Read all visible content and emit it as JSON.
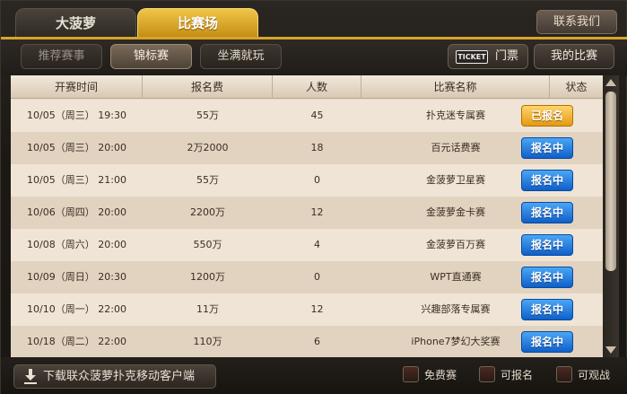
{
  "tabs": {
    "main": [
      "大菠萝",
      "比赛场"
    ],
    "active": 1,
    "contact": "联系我们"
  },
  "subtabs": {
    "items": [
      "推荐赛事",
      "锦标赛",
      "坐满就玩"
    ],
    "active": 1,
    "ticket_icon": "TICKET",
    "ticket_label": "门票",
    "my_matches": "我的比赛"
  },
  "table": {
    "headers": [
      "开赛时间",
      "报名费",
      "人数",
      "比赛名称",
      "状态"
    ],
    "rows": [
      {
        "time": "10/05（周三） 19:30",
        "fee": "55万",
        "count": "45",
        "name": "扑克迷专属赛",
        "status": "已报名",
        "status_style": "gold"
      },
      {
        "time": "10/05（周三） 20:00",
        "fee": "2万2000",
        "count": "18",
        "name": "百元话费赛",
        "status": "报名中",
        "status_style": "blue"
      },
      {
        "time": "10/05（周三） 21:00",
        "fee": "55万",
        "count": "0",
        "name": "金菠萝卫星赛",
        "status": "报名中",
        "status_style": "blue"
      },
      {
        "time": "10/06（周四） 20:00",
        "fee": "2200万",
        "count": "12",
        "name": "金菠萝金卡赛",
        "status": "报名中",
        "status_style": "blue"
      },
      {
        "time": "10/08（周六） 20:00",
        "fee": "550万",
        "count": "4",
        "name": "金菠萝百万赛",
        "status": "报名中",
        "status_style": "blue"
      },
      {
        "time": "10/09（周日） 20:30",
        "fee": "1200万",
        "count": "0",
        "name": "WPT直通赛",
        "status": "报名中",
        "status_style": "blue"
      },
      {
        "time": "10/10（周一） 22:00",
        "fee": "11万",
        "count": "12",
        "name": "兴趣部落专属赛",
        "status": "报名中",
        "status_style": "blue"
      },
      {
        "time": "10/18（周二） 22:00",
        "fee": "110万",
        "count": "6",
        "name": "iPhone7梦幻大奖赛",
        "status": "报名中",
        "status_style": "blue"
      }
    ]
  },
  "bottom": {
    "download": "下载联众菠萝扑克移动客户端",
    "legend": [
      "免费赛",
      "可报名",
      "可观战"
    ]
  },
  "icons": {
    "download": "download-arrow-icon",
    "ticket": "ticket-icon"
  }
}
